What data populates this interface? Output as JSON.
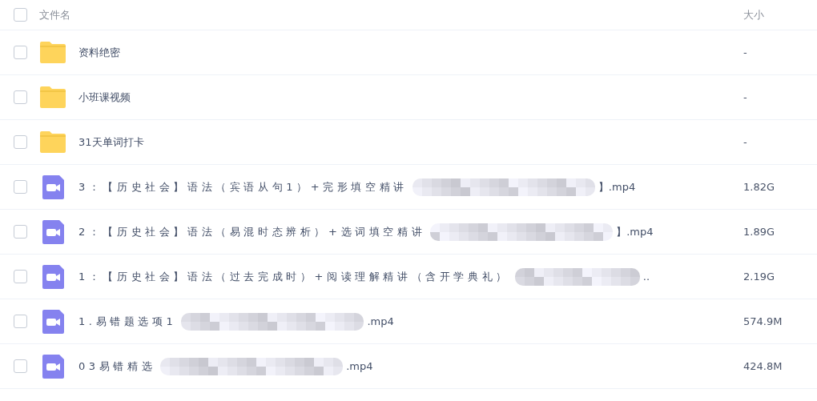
{
  "header": {
    "checked": false,
    "name": "文件名",
    "size": "大小"
  },
  "files": [
    {
      "kind": "folder",
      "checked": false,
      "name": "资料绝密",
      "redacted": false,
      "size": "-"
    },
    {
      "kind": "folder",
      "checked": false,
      "name": "小班课视频",
      "redacted": false,
      "size": "-"
    },
    {
      "kind": "folder",
      "checked": false,
      "name": "31天单词打卡",
      "redacted": false,
      "size": "-"
    },
    {
      "kind": "video",
      "checked": false,
      "name": "3：【历史社会】语法（宾语从句1）+完形填空精讲",
      "redacted": true,
      "suffix": "】.mp4",
      "size": "1.82G"
    },
    {
      "kind": "video",
      "checked": false,
      "name": "2：【历史社会】语法（易混时态辨析）+选词填空精讲",
      "redacted": true,
      "suffix": "】.mp4",
      "size": "1.89G"
    },
    {
      "kind": "video",
      "checked": false,
      "name": "1：【历史社会】语法（过去完成时）+阅读理解精讲（含开学典礼）",
      "redacted": true,
      "suffix": "..",
      "size": "2.19G"
    },
    {
      "kind": "video",
      "checked": false,
      "name": "1.易错题选项1",
      "redacted": true,
      "suffix": ".mp4",
      "size": "574.9M"
    },
    {
      "kind": "video",
      "checked": false,
      "name": "03易错精选",
      "redacted": true,
      "suffix": ".mp4",
      "size": "424.8M"
    }
  ]
}
